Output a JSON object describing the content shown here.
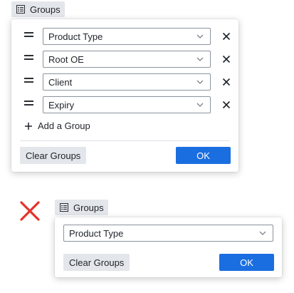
{
  "top_example": {
    "chip_label": "Groups",
    "chip_icon": "table-list-icon",
    "groups": [
      {
        "label": "Product Type"
      },
      {
        "label": "Root OE"
      },
      {
        "label": "Client"
      },
      {
        "label": "Expiry"
      }
    ],
    "add_group_label": "Add a Group",
    "clear_label": "Clear Groups",
    "ok_label": "OK"
  },
  "bottom_example": {
    "status_icon": "red-x-icon",
    "chip_label": "Groups",
    "chip_icon": "table-list-icon",
    "select_value": "Product Type",
    "clear_label": "Clear Groups",
    "ok_label": "OK"
  },
  "colors": {
    "primary": "#1a6ee0",
    "secondary": "#e3e6ea",
    "incorrect": "#e5322a"
  }
}
